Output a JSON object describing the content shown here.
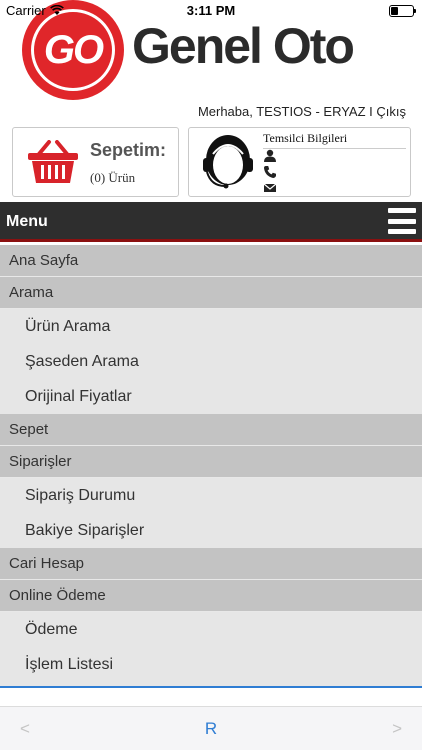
{
  "status_bar": {
    "carrier": "Carrier",
    "time": "3:11 PM",
    "wifi_icon": "wifi-icon",
    "battery_icon": "battery-icon"
  },
  "header": {
    "logo_badge": "GO",
    "logo_text": "Genel Oto",
    "greeting": "Merhaba, TESTIOS - ERYAZ  I Çıkış"
  },
  "cart": {
    "title": "Sepetim:",
    "count": "(0) Ürün",
    "icon": "shopping-basket-icon"
  },
  "representative": {
    "title": "Temsilci Bilgileri",
    "icons": [
      "user-icon",
      "phone-icon",
      "mail-icon"
    ]
  },
  "menu": {
    "title": "Menu",
    "items": [
      {
        "label": "Ana Sayfa",
        "type": "cat"
      },
      {
        "label": "Arama",
        "type": "cat"
      },
      {
        "label": "Ürün Arama",
        "type": "sub"
      },
      {
        "label": "Şaseden Arama",
        "type": "sub"
      },
      {
        "label": "Orijinal Fiyatlar",
        "type": "sub"
      },
      {
        "label": "Sepet",
        "type": "cat"
      },
      {
        "label": "Siparişler",
        "type": "cat"
      },
      {
        "label": "Sipariş Durumu",
        "type": "sub"
      },
      {
        "label": "Bakiye Siparişler",
        "type": "sub"
      },
      {
        "label": "Cari Hesap",
        "type": "cat"
      },
      {
        "label": "Online Ödeme",
        "type": "cat"
      },
      {
        "label": "Ödeme",
        "type": "sub"
      },
      {
        "label": "İşlem Listesi",
        "type": "sub"
      }
    ]
  },
  "bottom_nav": {
    "back": "<",
    "refresh": "R",
    "forward": ">"
  },
  "colors": {
    "brand_red": "#e0262a",
    "menu_bar": "#2e2e2e",
    "accent_blue": "#2f7dd3"
  }
}
